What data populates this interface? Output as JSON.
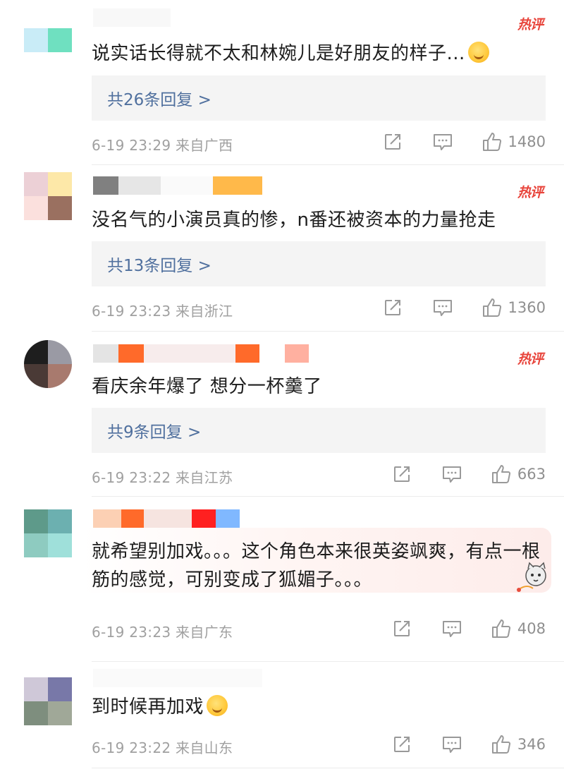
{
  "hot_label": "热评",
  "comments": [
    {
      "content": "说实话长得就不太和林婉儿是好朋友的样子...",
      "has_emoji": true,
      "replies": "共26条回复 >",
      "meta": "6-19 23:29  来自广西",
      "likes": "1480",
      "hot": true,
      "avatar_colors": [
        "#c9ecf7",
        "#6fe0c0",
        "#ffffff",
        "#ffffff"
      ],
      "name_colors": [
        "#ffffff"
      ]
    },
    {
      "content": "没名气的小演员真的惨，n番还被资本的力量抢走",
      "replies": "共13条回复 >",
      "meta": "6-19 23:23  来自浙江",
      "likes": "1360",
      "hot": true,
      "avatar_colors": [
        "#ecd0d6",
        "#fde8a8",
        "#fbe0dd",
        "#9a7060"
      ],
      "name_colors": [
        "#808080",
        "#dcdcdc",
        "#ffffff",
        "#ffb94a"
      ]
    },
    {
      "content": "看庆余年爆了 想分一杯羹了",
      "replies": "共9条回复 >",
      "meta": "6-19 23:22  来自江苏",
      "likes": "663",
      "hot": true,
      "avatar_colors": [
        "#1e1e1e",
        "#9a9aa4",
        "#4a3a36",
        "#a87a6e"
      ],
      "name_colors": [
        "#dddddd",
        "#ff6a2a",
        "#f4e6e6",
        "#ff6a2a",
        "#ffb0a0"
      ]
    },
    {
      "content": "就希望别加戏。。。这个角色本来很英姿飒爽，有点一根筋的感觉，可别变成了狐媚子。。。",
      "replies": "",
      "meta": "6-19 23:23  来自广东",
      "likes": "408",
      "hot": false,
      "avatar_colors": [
        "#5e9a8a",
        "#6cb0b0",
        "#8ecbc0",
        "#9fe0da"
      ],
      "name_colors": [
        "#fcd0b4",
        "#ff6a2a",
        "#f6e4e0",
        "#ff2020",
        "#80b8ff"
      ]
    },
    {
      "content": "到时候再加戏",
      "has_emoji": true,
      "replies": "",
      "meta": "6-19 23:22  来自山东",
      "likes": "346",
      "hot": false,
      "avatar_colors": [
        "#cfc8d8",
        "#7878a8",
        "#7e8e7e",
        "#a0a898"
      ],
      "name_colors": [
        "#ffffff"
      ]
    }
  ]
}
